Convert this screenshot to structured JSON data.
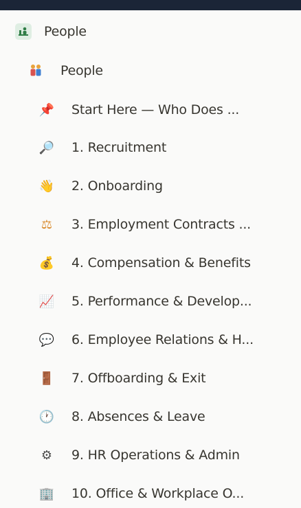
{
  "sidebar": {
    "teamspace": {
      "label": "People",
      "icon": "teamspace-people-icon"
    },
    "page": {
      "label": "People",
      "icon": "people-icon"
    },
    "children": [
      {
        "label": "Start Here — Who Does ...",
        "icon": "pushpin-icon",
        "glyph": "📌"
      },
      {
        "label": "1. Recruitment",
        "icon": "magnifier-icon",
        "glyph": "🔎"
      },
      {
        "label": "2. Onboarding",
        "icon": "waving-hand-icon",
        "glyph": "👋"
      },
      {
        "label": "3. Employment Contracts ...",
        "icon": "scales-icon",
        "glyph": "⚖"
      },
      {
        "label": "4. Compensation & Benefits",
        "icon": "money-bag-icon",
        "glyph": "💰"
      },
      {
        "label": "5. Performance & Develop...",
        "icon": "chart-board-icon",
        "glyph": "📈"
      },
      {
        "label": "6. Employee Relations & H...",
        "icon": "speech-bubble-icon",
        "glyph": "💬"
      },
      {
        "label": "7. Offboarding & Exit",
        "icon": "door-icon",
        "glyph": "🚪"
      },
      {
        "label": "8. Absences & Leave",
        "icon": "clock-icon",
        "glyph": "🕐"
      },
      {
        "label": "9. HR Operations & Admin",
        "icon": "gear-icon",
        "glyph": "⚙"
      },
      {
        "label": "10. Office & Workplace O...",
        "icon": "office-building-icon",
        "glyph": "🏢"
      }
    ]
  },
  "colors": {
    "frame": "#1b2537",
    "panel": "#fafaf9",
    "text": "#37352f"
  }
}
